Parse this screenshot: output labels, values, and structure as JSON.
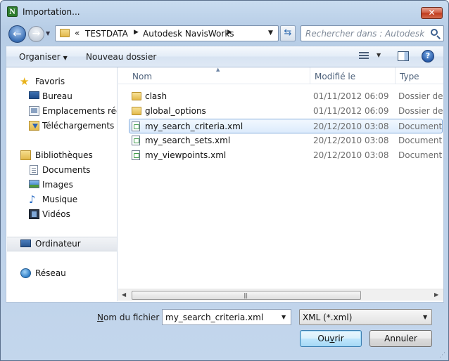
{
  "window": {
    "title": "Importation...",
    "close_symbol": "✕",
    "app_icon_letter": "N"
  },
  "navigation": {
    "back_symbol": "←",
    "forward_symbol": "→",
    "breadcrumb_prefix": "«",
    "breadcrumb": [
      "TESTDATA",
      "Autodesk NavisWorks"
    ],
    "refresh_symbol": "⇆",
    "search_placeholder": "Rechercher dans : Autodesk N..."
  },
  "toolbar": {
    "organize_label": "Organiser",
    "new_folder_label": "Nouveau dossier",
    "help_symbol": "?"
  },
  "sidebar": {
    "groups": [
      {
        "label": "Favoris",
        "icon": "star-icon",
        "items": [
          {
            "label": "Bureau",
            "icon": "desktop-icon"
          },
          {
            "label": "Emplacements récents",
            "icon": "recent-places-icon"
          },
          {
            "label": "Téléchargements",
            "icon": "downloads-icon"
          }
        ]
      },
      {
        "label": "Bibliothèques",
        "icon": "libraries-icon",
        "items": [
          {
            "label": "Documents",
            "icon": "documents-icon"
          },
          {
            "label": "Images",
            "icon": "images-icon"
          },
          {
            "label": "Musique",
            "icon": "music-icon"
          },
          {
            "label": "Vidéos",
            "icon": "videos-icon"
          }
        ]
      },
      {
        "label": "Ordinateur",
        "icon": "computer-icon",
        "selected": true,
        "items": []
      },
      {
        "label": "Réseau",
        "icon": "network-icon",
        "items": []
      }
    ]
  },
  "file_list": {
    "columns": [
      "Nom",
      "Modifié le",
      "Type"
    ],
    "rows": [
      {
        "name": "clash",
        "modified": "01/11/2012 06:09",
        "type": "Dossier de fichiers",
        "kind": "folder",
        "selected": false
      },
      {
        "name": "global_options",
        "modified": "01/11/2012 06:09",
        "type": "Dossier de fichiers",
        "kind": "folder",
        "selected": false
      },
      {
        "name": "my_search_criteria.xml",
        "modified": "20/12/2010 03:08",
        "type": "Document XML",
        "kind": "xml",
        "selected": true
      },
      {
        "name": "my_search_sets.xml",
        "modified": "20/12/2010 03:08",
        "type": "Document XML",
        "kind": "xml",
        "selected": false
      },
      {
        "name": "my_viewpoints.xml",
        "modified": "20/12/2010 03:08",
        "type": "Document XML",
        "kind": "xml",
        "selected": false
      }
    ]
  },
  "footer": {
    "filename_label_accel": "N",
    "filename_label_rest": "om du fichier :",
    "filename_value": "my_search_criteria.xml",
    "filter_value": "XML (*.xml)",
    "open_label_pre": "Ou",
    "open_label_accel": "v",
    "open_label_post": "rir",
    "cancel_label": "Annuler"
  },
  "colors": {
    "accent": "#3c7fb1",
    "selection": "#dcebfc",
    "close_button": "#c0391b"
  }
}
